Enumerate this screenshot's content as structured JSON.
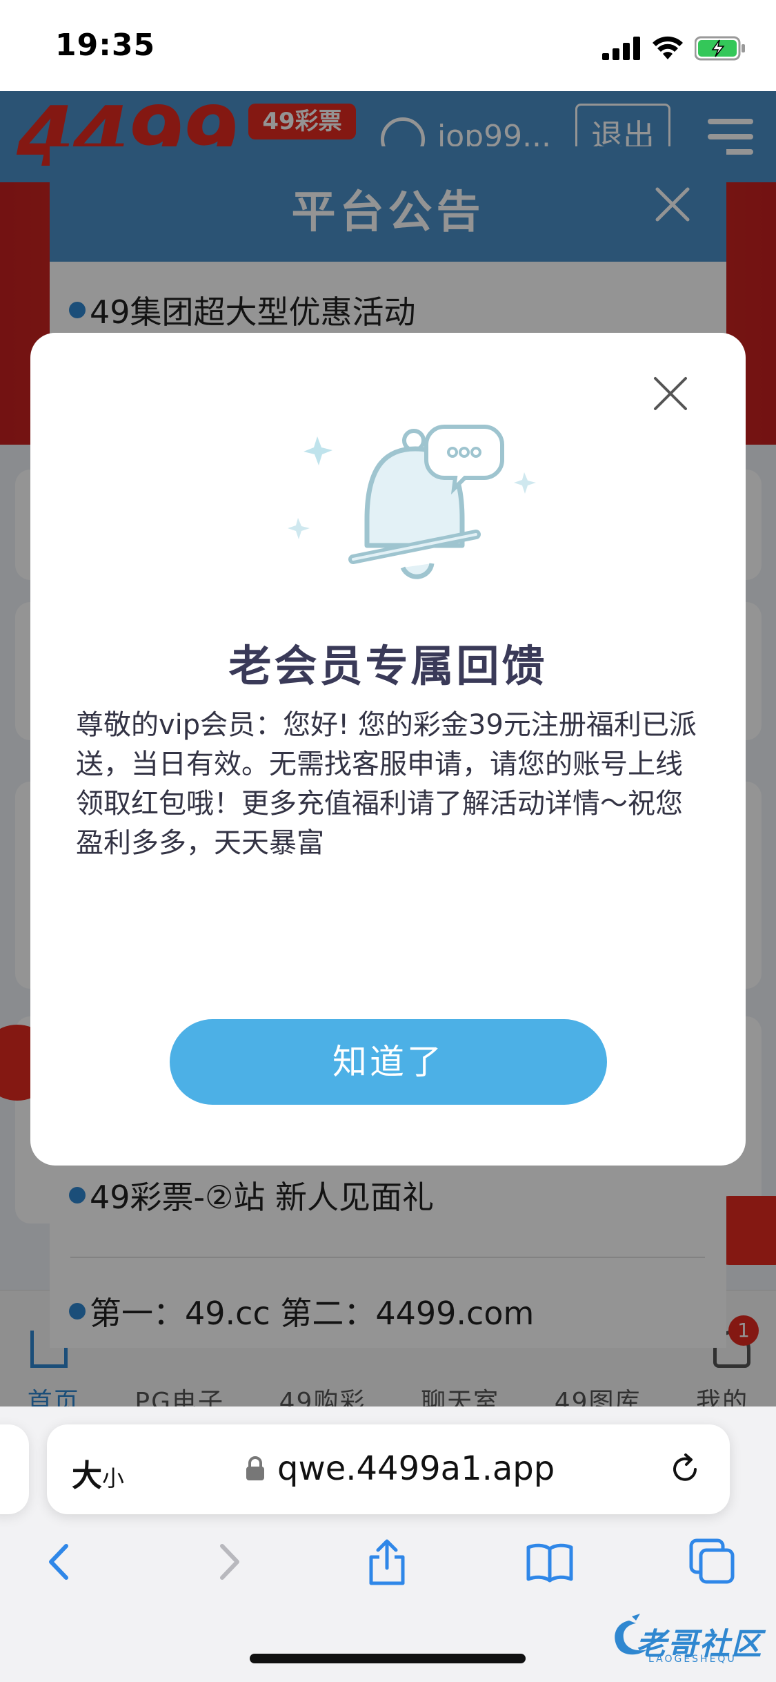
{
  "status_bar": {
    "time": "19:35"
  },
  "site": {
    "logo_text": "4499",
    "logo_badge": "49彩票",
    "username": "iop99...",
    "logout_label": "退出",
    "tabs": [
      {
        "label": "首页",
        "active": true
      },
      {
        "label": "PG电子",
        "active": false
      },
      {
        "label": "49购彩",
        "active": false
      },
      {
        "label": "聊天室",
        "active": false
      },
      {
        "label": "49图库",
        "active": false
      },
      {
        "label": "我的",
        "active": false
      }
    ],
    "tab_badge": "1"
  },
  "notice": {
    "title": "平台公告",
    "items": [
      "49集团超大型优惠活动",
      "49彩票-②站 新人见面礼",
      "第一：49.cc 第二：4499.com"
    ]
  },
  "modal": {
    "title": "老会员专属回馈",
    "body": "尊敬的vip会员：您好! 您的彩金39元注册福利已派送，当日有效。无需找客服申请，请您的账号上线领取红包哦！更多充值福利请了解活动详情～祝您盈利多多，天天暴富",
    "button_label": "知道了"
  },
  "browser": {
    "text_size_label": "大",
    "text_size_small": "小",
    "url": "qwe.4499a1.app"
  },
  "watermark": {
    "text": "老哥社区",
    "sub": "LAOGESHEQU"
  },
  "colors": {
    "header_blue": "#4a90c8",
    "button_blue": "#4cb0e6",
    "accent_red": "#e42a1f",
    "title_text": "#3a3a58"
  }
}
